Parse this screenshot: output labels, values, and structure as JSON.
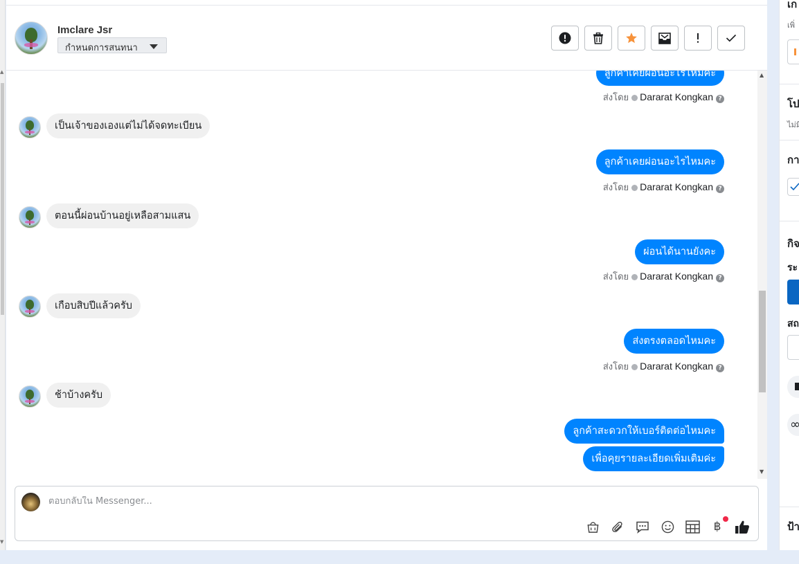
{
  "header": {
    "contact_name": "Imclare Jsr",
    "status_dropdown": "กำหนดการสนทนา",
    "buttons": [
      {
        "name": "spam-button",
        "icon": "alert-circle-icon"
      },
      {
        "name": "delete-button",
        "icon": "trash-icon"
      },
      {
        "name": "star-button",
        "icon": "star-icon",
        "color": "#f7923a"
      },
      {
        "name": "mark-unread-button",
        "icon": "envelope-icon"
      },
      {
        "name": "follow-up-button",
        "icon": "exclamation-icon"
      },
      {
        "name": "done-button",
        "icon": "checkmark-icon"
      }
    ]
  },
  "messages": [
    {
      "direction": "out",
      "text": "ลูกค้าเคยผ่อนอะไรไหมคะ",
      "partial": true
    },
    {
      "direction": "meta",
      "sent_label": "ส่งโดย",
      "sender": "Dararat Kongkan"
    },
    {
      "direction": "in",
      "text": "เป็นเจ้าของเองแต่ไม่ได้จดทะเบียน"
    },
    {
      "direction": "out",
      "text": "ลูกค้าเคยผ่อนอะไรไหมคะ"
    },
    {
      "direction": "meta",
      "sent_label": "ส่งโดย",
      "sender": "Dararat Kongkan"
    },
    {
      "direction": "in",
      "text": "ตอนนี้ผ่อนบ้านอยู่เหลือสามแสน"
    },
    {
      "direction": "out",
      "text": "ผ่อนได้นานยังคะ"
    },
    {
      "direction": "meta",
      "sent_label": "ส่งโดย",
      "sender": "Dararat Kongkan"
    },
    {
      "direction": "in",
      "text": "เกือบสิบปีแล้วครับ"
    },
    {
      "direction": "out",
      "text": "ส่งตรงตลอดไหมคะ"
    },
    {
      "direction": "meta",
      "sent_label": "ส่งโดย",
      "sender": "Dararat Kongkan"
    },
    {
      "direction": "in",
      "text": "ช้าบ้างครับ"
    },
    {
      "direction": "out",
      "text": "ลูกค้าสะดวกให้เบอร์ติดต่อไหมคะ"
    },
    {
      "direction": "out",
      "text": "เพื่อคุยรายละเอียดเพิ่มเติมค่ะ"
    }
  ],
  "composer": {
    "placeholder": "ตอบกลับใน Messenger...",
    "icons": [
      "shopping-bag-icon",
      "paperclip-icon",
      "saved-reply-icon",
      "emoji-icon",
      "table-icon",
      "baht-icon",
      "thumbs-up-icon"
    ]
  },
  "right_panel": {
    "sections": [
      "เก",
      "เพิ่",
      "โป",
      "ไม่มี",
      "กา",
      "กิจ",
      "ระ",
      "สถ",
      "ป้า"
    ]
  },
  "colors": {
    "accent": "#0084ff",
    "star": "#f7923a",
    "notification": "#f02849"
  }
}
